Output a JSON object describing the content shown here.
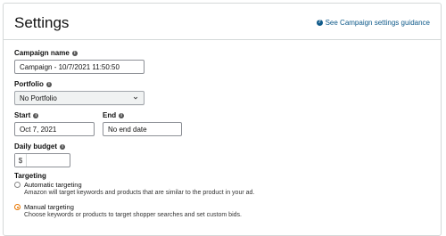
{
  "header": {
    "title": "Settings",
    "guide_link": "See Campaign settings guidance",
    "guide_icon": "?"
  },
  "campaign_name": {
    "label": "Campaign name",
    "value": "Campaign - 10/7/2021 11:50:50"
  },
  "portfolio": {
    "label": "Portfolio",
    "selected": "No Portfolio"
  },
  "start": {
    "label": "Start",
    "value": "Oct 7, 2021"
  },
  "end": {
    "label": "End",
    "value": "No end date"
  },
  "daily_budget": {
    "label": "Daily budget",
    "currency": "$",
    "value": ""
  },
  "targeting": {
    "label": "Targeting",
    "options": [
      {
        "title": "Automatic targeting",
        "description": "Amazon will target keywords and products that are similar to the product in your ad.",
        "selected": false
      },
      {
        "title": "Manual targeting",
        "description": "Choose keywords or products to target shopper searches and set custom bids.",
        "selected": true
      }
    ]
  },
  "colors": {
    "link": "#0f5a8a",
    "radio_selected": "#e77600",
    "border": "#d5d9d9"
  },
  "icons": {
    "info": "info-icon",
    "help": "help-circle-icon",
    "chevron": "chevron-down-icon"
  }
}
